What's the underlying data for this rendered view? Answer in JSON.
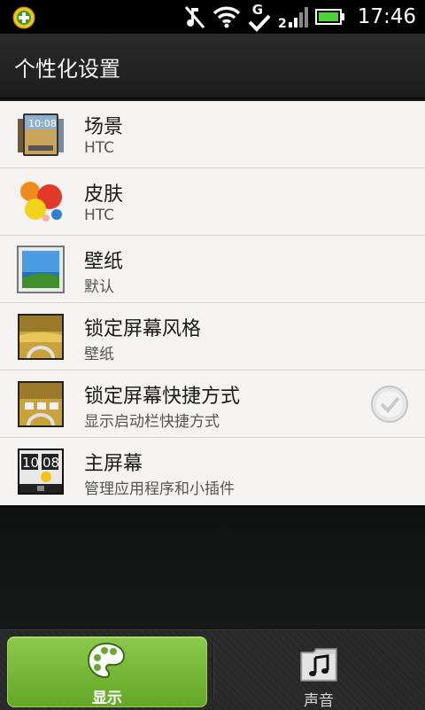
{
  "status_bar": {
    "time": "17:46",
    "network_type": "G",
    "icons": [
      "app-plus-icon",
      "mute-icon",
      "wifi-icon",
      "check-icon",
      "signal-icon",
      "battery-icon"
    ]
  },
  "header": {
    "title": "个性化设置"
  },
  "list": {
    "items": [
      {
        "title": "场景",
        "subtitle": "HTC",
        "icon": "scene-icon"
      },
      {
        "title": "皮肤",
        "subtitle": "HTC",
        "icon": "skin-icon"
      },
      {
        "title": "壁纸",
        "subtitle": "默认",
        "icon": "wallpaper-icon"
      },
      {
        "title": "锁定屏幕风格",
        "subtitle": "壁纸",
        "icon": "lockscreen-style-icon"
      },
      {
        "title": "锁定屏幕快捷方式",
        "subtitle": "显示启动栏快捷方式",
        "icon": "lockscreen-shortcut-icon",
        "checkbox": true
      },
      {
        "title": "主屏幕",
        "subtitle": "管理应用程序和小插件",
        "icon": "home-screen-icon"
      }
    ]
  },
  "home_icon_clock": {
    "hours": "10",
    "minutes": "08"
  },
  "tabs": [
    {
      "label": "显示",
      "icon": "palette-icon",
      "active": true
    },
    {
      "label": "声音",
      "icon": "music-folder-icon",
      "active": false
    }
  ],
  "colors": {
    "accent_green": "#7dbd3c",
    "list_background": "#f4f3f1",
    "title_bar": "#222322",
    "battery_green": "#4cd136"
  }
}
